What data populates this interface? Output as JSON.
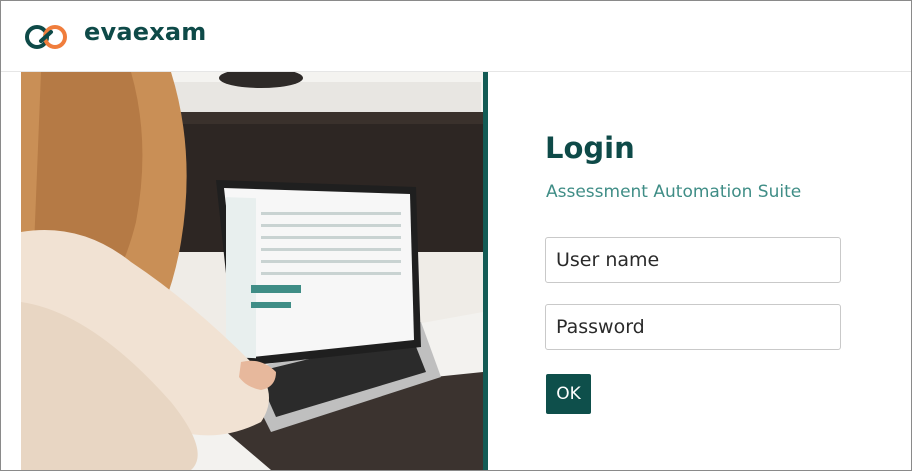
{
  "header": {
    "brand": "evaexam",
    "logo_icon": "evaexam-logo-icon"
  },
  "login": {
    "title": "Login",
    "subtitle": "Assessment Automation Suite",
    "username_placeholder": "User name",
    "password_placeholder": "Password",
    "ok_label": "OK"
  },
  "photo": {
    "icon": "woman-using-laptop-photo"
  },
  "colors": {
    "brand_dark": "#0e4a48",
    "accent_teal": "#3f8d86",
    "orange": "#f07d3c",
    "button": "#0e4f4b",
    "divider": "#135b55"
  }
}
